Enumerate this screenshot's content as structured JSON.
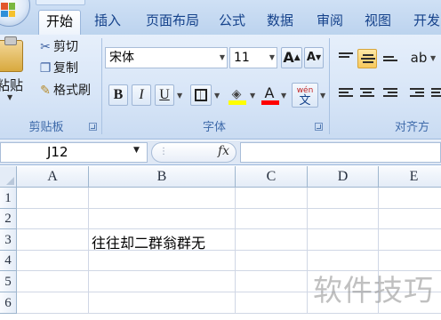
{
  "tabs": [
    {
      "label": "开始",
      "active": true
    },
    {
      "label": "插入"
    },
    {
      "label": "页面布局"
    },
    {
      "label": "公式"
    },
    {
      "label": "数据"
    },
    {
      "label": "审阅"
    },
    {
      "label": "视图"
    },
    {
      "label": "开发"
    }
  ],
  "clipboard": {
    "paste_label": "粘贴",
    "cut_label": "剪切",
    "copy_label": "复制",
    "format_painter_label": "格式刷",
    "group_label": "剪贴板"
  },
  "font": {
    "font_name": "宋体",
    "font_size": "11",
    "grow_label": "A",
    "shrink_label": "A",
    "bold_label": "B",
    "italic_label": "I",
    "underline_label": "U",
    "font_color_label": "A",
    "phonetic_label": "wén",
    "phonetic_char": "文",
    "group_label": "字体",
    "highlight_color": "#ffff00",
    "font_color": "#ff0000"
  },
  "alignment": {
    "group_label": "对齐方"
  },
  "formula_bar": {
    "name_box": "J12",
    "fx_label": "fx",
    "formula": ""
  },
  "columns": [
    "A",
    "B",
    "C",
    "D",
    "E"
  ],
  "rows": [
    "1",
    "2",
    "3",
    "4",
    "5",
    "6"
  ],
  "cells": {
    "B3": "往往却二群翁群无"
  },
  "watermark": "软件技巧",
  "colors": {
    "ribbon_bg": "#d7e5f7",
    "tab_text": "#15428b",
    "selected_align": "#f7c95c",
    "grid_line": "#d0d7e5"
  }
}
